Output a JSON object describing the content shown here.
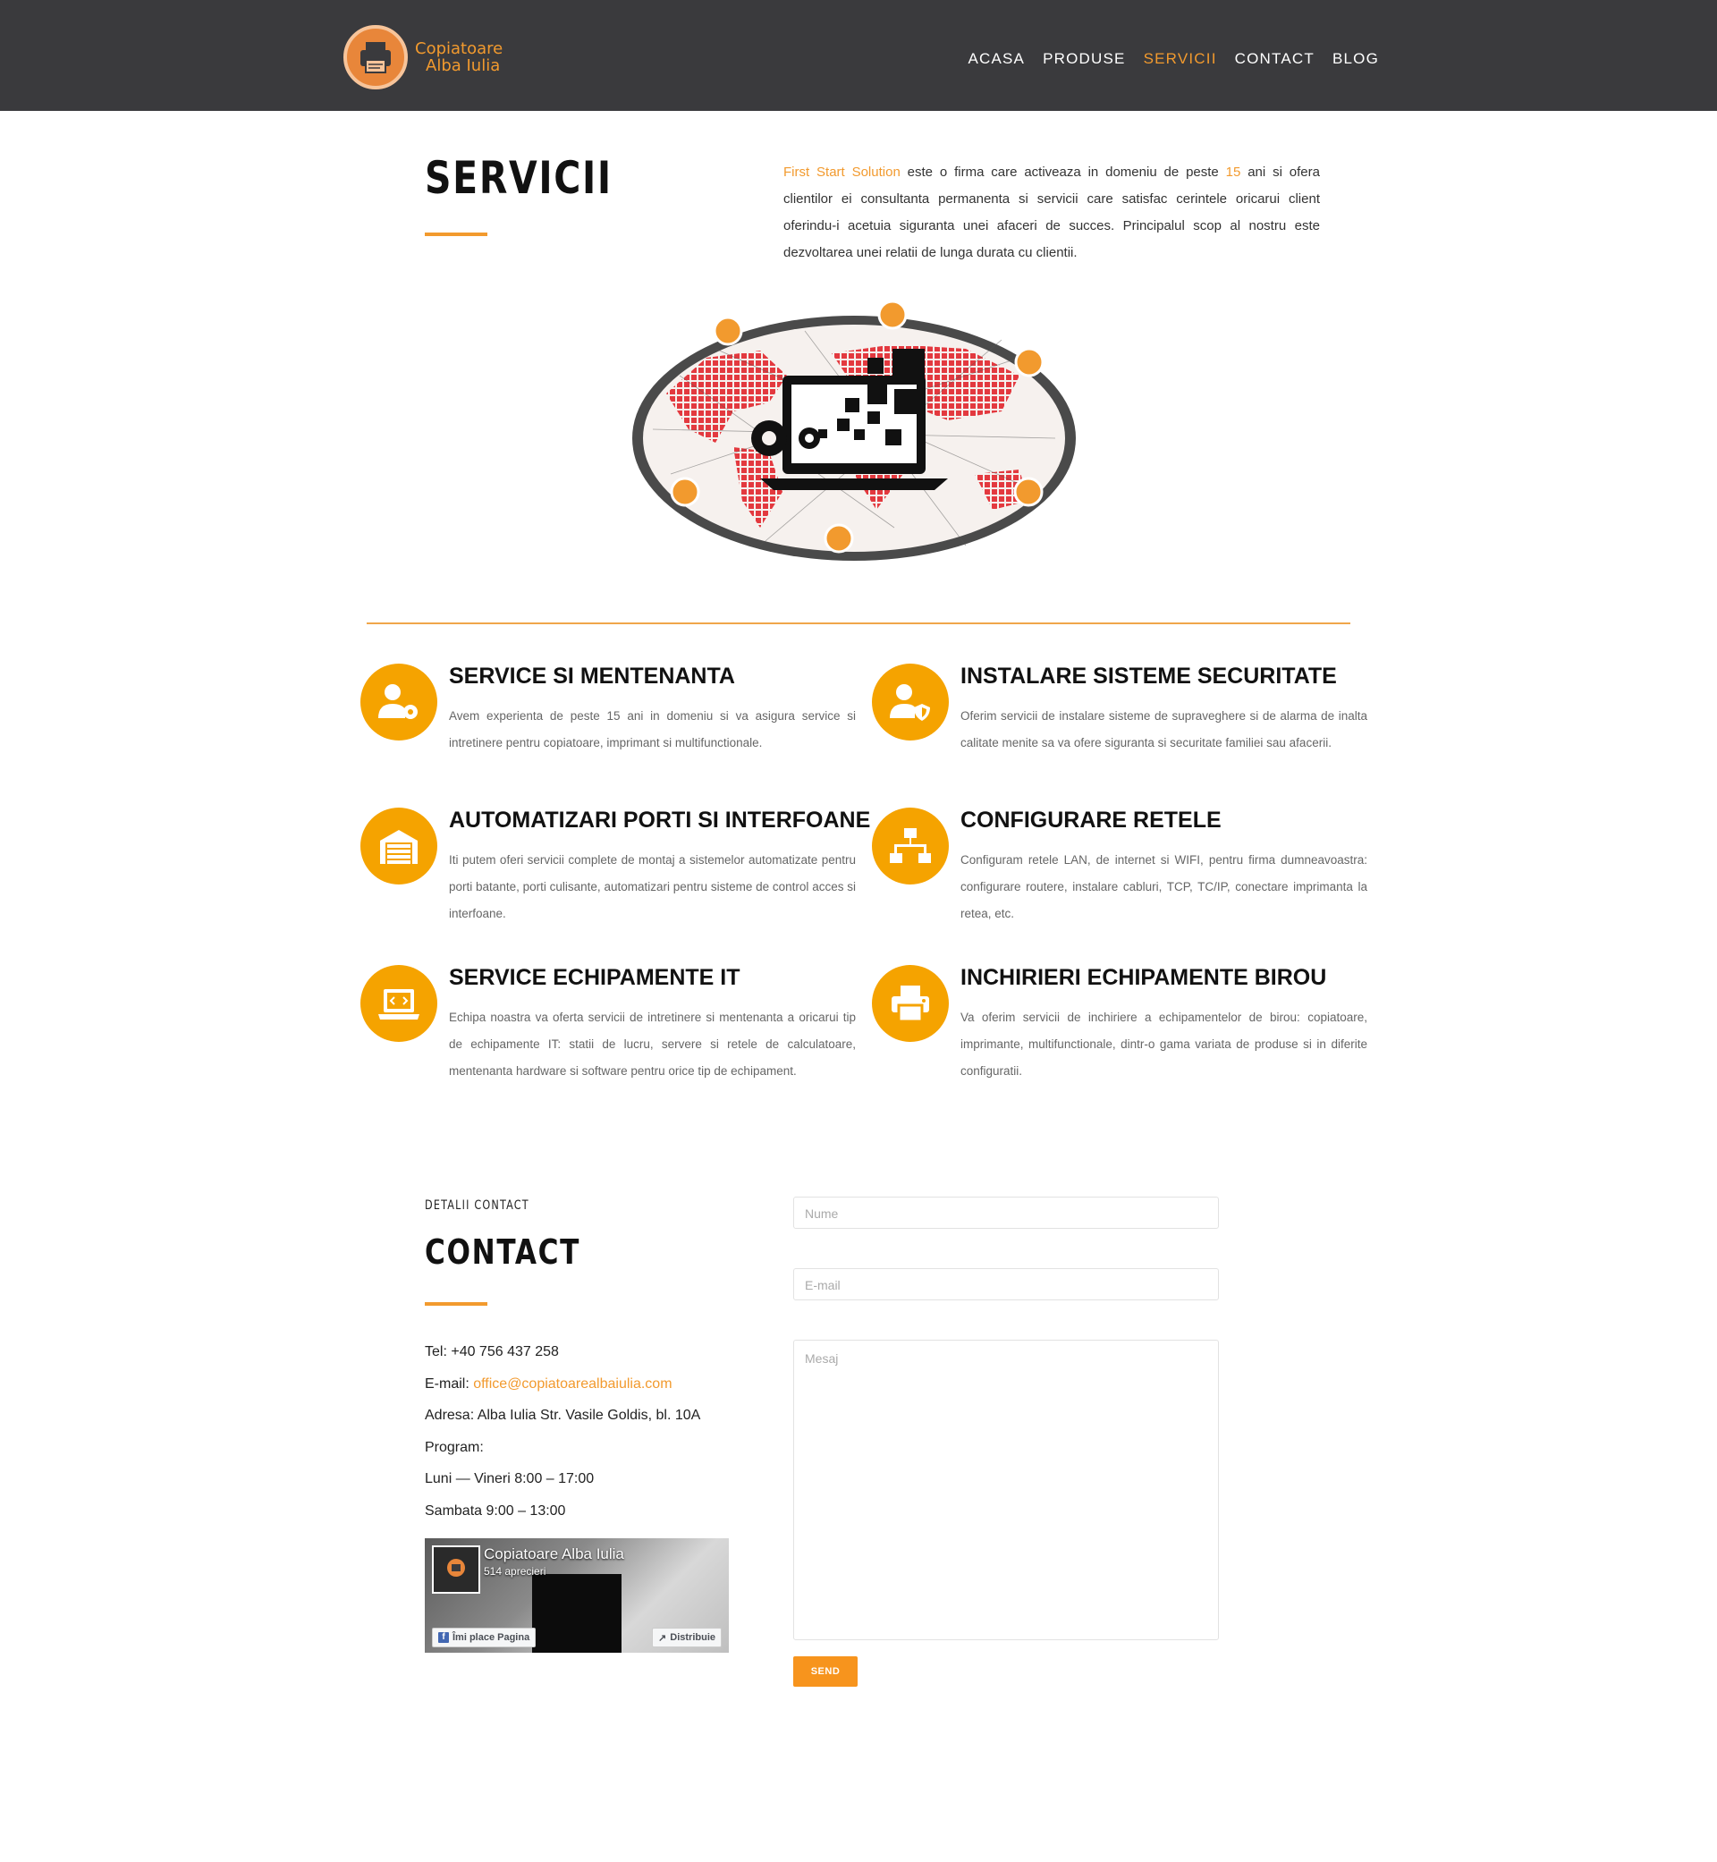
{
  "header": {
    "logo": {
      "line1": "Copiatoare",
      "line2": "Alba Iulia"
    },
    "nav": [
      {
        "label": "ACASA",
        "active": false
      },
      {
        "label": "PRODUSE",
        "active": false
      },
      {
        "label": "SERVICII",
        "active": true
      },
      {
        "label": "CONTACT",
        "active": false
      },
      {
        "label": "BLOG",
        "active": false
      }
    ]
  },
  "servicii": {
    "title": "SERVICII",
    "intro": {
      "company": "First Start Solution",
      "part1": " este o firma care activeaza in domeniu de peste ",
      "years": "15",
      "part2": " ani si ofera clientilor ei consultanta permanenta si servicii care satisfac cerintele oricarui client oferindu-i acetuia siguranta unei afaceri de succes. Principalul scop al nostru este dezvoltarea unei relatii de lunga durata cu clientii."
    }
  },
  "services": [
    {
      "title": "SERVICE SI MENTENANTA",
      "icon": "user-gear-icon",
      "desc": "Avem experienta de peste 15 ani in domeniu si va asigura service si intretinere pentru copiatoare, imprimant si multifunctionale."
    },
    {
      "title": "INSTALARE SISTEME SECURITATE",
      "icon": "user-shield-icon",
      "desc": "Oferim servicii de instalare sisteme de supraveghere si de alarma de inalta calitate menite sa va ofere siguranta si securitate familiei sau afacerii."
    },
    {
      "title": "AUTOMATIZARI PORTI SI INTERFOANE",
      "icon": "garage-door-icon",
      "desc": "Iti putem oferi servicii complete de montaj a sistemelor automatizate pentru porti batante, porti culisante, automatizari pentru sisteme de control acces si interfoane."
    },
    {
      "title": "CONFIGURARE RETELE",
      "icon": "network-icon",
      "desc": "Configuram retele LAN, de internet si WIFI, pentru firma dumneavoastra: configurare routere, instalare cabluri, TCP, TC/IP, conectare imprimanta la retea, etc."
    },
    {
      "title": "SERVICE ECHIPAMENTE IT",
      "icon": "laptop-code-icon",
      "desc": "Echipa noastra va oferta servicii de intretinere si mentenanta a oricarui tip de echipamente IT: statii de lucru, servere si retele de calculatoare, mentenanta hardware si software pentru orice tip de echipament."
    },
    {
      "title": "INCHIRIERI ECHIPAMENTE BIROU",
      "icon": "printer-icon",
      "desc": "Va oferim servicii de inchiriere a echipamentelor de birou: copiatoare, imprimante, multifunctionale, dintr-o gama variata de produse si in diferite configuratii."
    }
  ],
  "contact": {
    "small_label": "DETALII CONTACT",
    "title": "CONTACT",
    "tel": "Tel: +40 756 437 258",
    "email_label": "E-mail: ",
    "email": "office@copiatoarealbaiulia.com",
    "address": "Adresa: Alba Iulia Str. Vasile Goldis, bl. 10A",
    "program_label": "Program:",
    "weekdays": "Luni — Vineri 8:00 – 17:00",
    "saturday": "Sambata 9:00 – 13:00",
    "facebook": {
      "page_name": "Copiatoare Alba Iulia",
      "likes": "514 aprecieri",
      "like_button": "Îmi place Pagina",
      "share_button": "Distribuie"
    },
    "form": {
      "name_placeholder": "Nume",
      "email_placeholder": "E-mail",
      "message_placeholder": "Mesaj",
      "send_label": "SEND"
    }
  },
  "colors": {
    "accent": "#f29a2e",
    "header_bg": "#3a3a3d",
    "icon_bg": "#f5a300"
  }
}
